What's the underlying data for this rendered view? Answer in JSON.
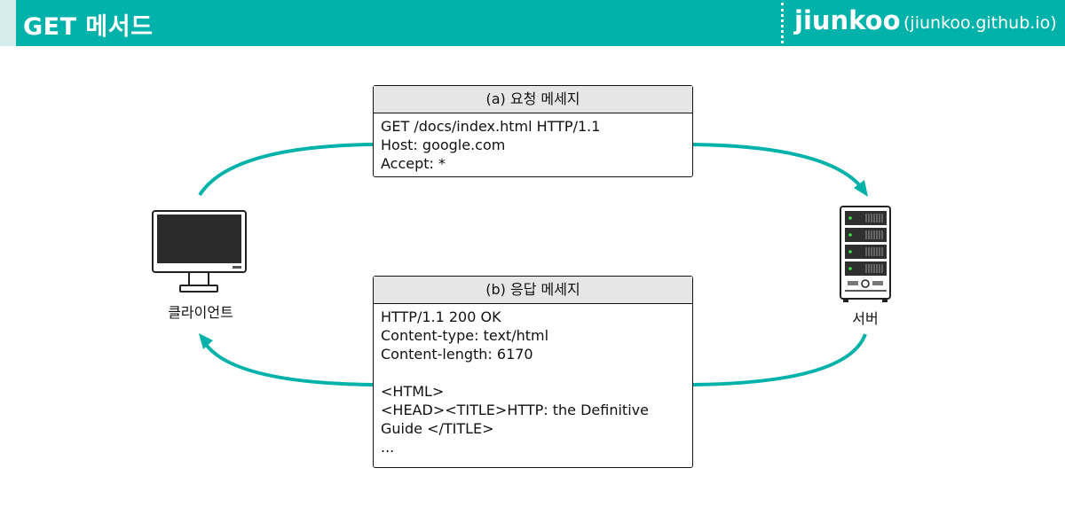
{
  "header": {
    "title": "GET 메서드",
    "brand_name": "jiunkoo",
    "brand_url": "(jiunkoo.github.io)"
  },
  "colors": {
    "header_bg": "#00b2a9",
    "arrow": "#00b2a9",
    "box_header": "#e6e6e6"
  },
  "nodes": {
    "client": {
      "label": "클라이언트",
      "icon": "monitor-icon"
    },
    "server": {
      "label": "서버",
      "icon": "server-rack-icon"
    }
  },
  "request": {
    "title": "(a) 요청 메세지",
    "lines": [
      "GET /docs/index.html HTTP/1.1",
      "Host: google.com",
      "Accept: *"
    ]
  },
  "response": {
    "title": "(b) 응답 메세지",
    "lines": [
      "HTTP/1.1 200 OK",
      "Content-type: text/html",
      "Content-length: 6170",
      "",
      "<HTML>",
      "<HEAD><TITLE>HTTP: the Definitive",
      "Guide </TITLE>",
      "..."
    ]
  }
}
